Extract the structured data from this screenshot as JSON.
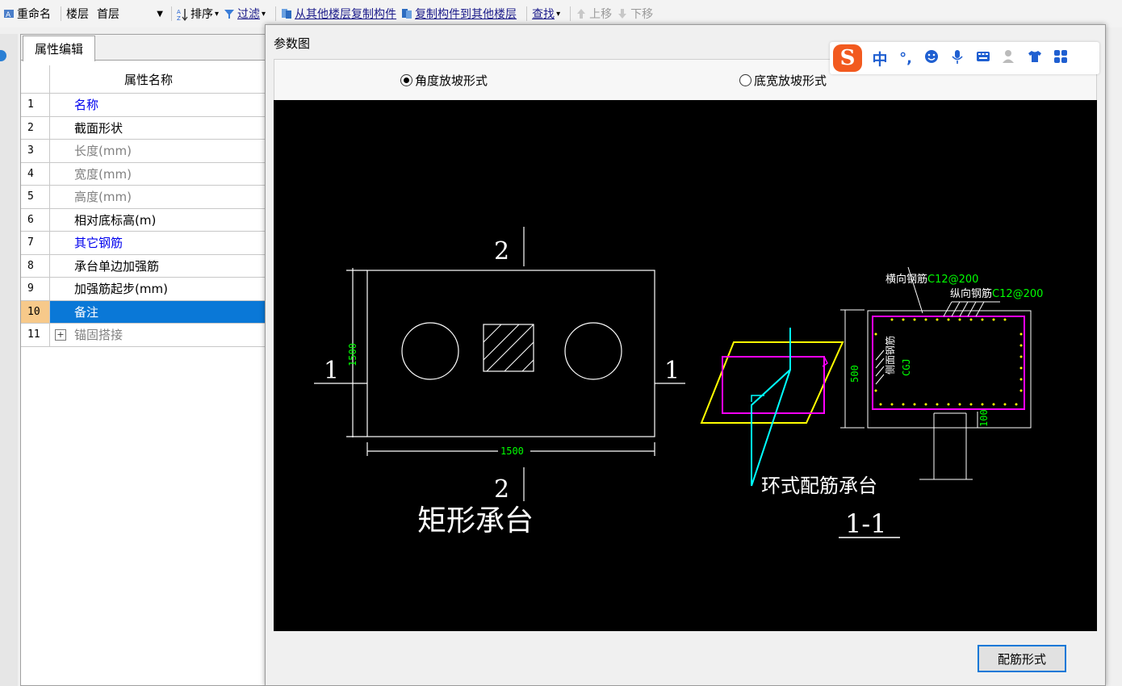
{
  "toolbar": {
    "rename": "重命名",
    "floor_label": "楼层",
    "floor_value": "首层",
    "sort": "排序",
    "filter": "过滤",
    "copy_from": "从其他楼层复制构件",
    "copy_to": "复制构件到其他楼层",
    "find": "查找",
    "move_up": "上移",
    "move_down": "下移"
  },
  "panel": {
    "tab": "属性编辑",
    "column_header": "属性名称",
    "rows": [
      {
        "num": "1",
        "name": "名称"
      },
      {
        "num": "2",
        "name": "截面形状"
      },
      {
        "num": "3",
        "name": "长度(mm)"
      },
      {
        "num": "4",
        "name": "宽度(mm)"
      },
      {
        "num": "5",
        "name": "高度(mm)"
      },
      {
        "num": "6",
        "name": "相对底标高(m)"
      },
      {
        "num": "7",
        "name": "其它钢筋"
      },
      {
        "num": "8",
        "name": "承台单边加强筋"
      },
      {
        "num": "9",
        "name": "加强筋起步(mm)"
      },
      {
        "num": "10",
        "name": "备注"
      },
      {
        "num": "11",
        "name": "锚固搭接",
        "expander": "+"
      }
    ]
  },
  "dialog": {
    "title": "参数图",
    "radio_angle": "角度放坡形式",
    "radio_bottom": "底宽放坡形式",
    "button": "配筋形式",
    "drawing": {
      "section_2_top": "2",
      "section_2_bottom": "2",
      "section_1_left": "1",
      "section_1_right": "1",
      "dim_height": "1500",
      "dim_width": "1500",
      "title_rect": "矩形承台",
      "label_transverse": "横向钢筋",
      "value_transverse": "C12@200",
      "label_longitudinal": "纵向钢筋",
      "value_longitudinal": "C12@200",
      "label_side": "侧面钢筋",
      "value_side": "CGJ",
      "dim_500": "500",
      "dim_100": "100",
      "title_ring": "环式配筋承台",
      "title_section": "1-1"
    }
  },
  "ime": {
    "logo": "S",
    "lang": "中",
    "punct": "°,"
  },
  "colors": {
    "selection": "#0a78d7",
    "canvas": "#000000",
    "dim_green": "#00ff00",
    "magenta": "#ff00ff",
    "yellow": "#ffff00",
    "cyan": "#00ffff",
    "ime_brand": "#f25a1f"
  }
}
